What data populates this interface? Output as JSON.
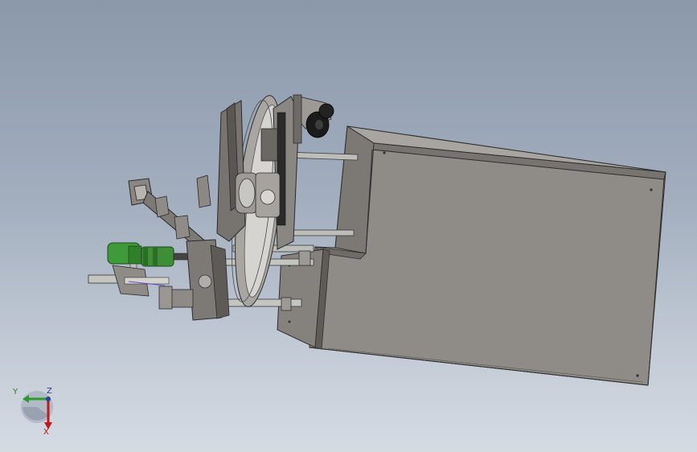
{
  "viewport": {
    "background_top": "#8a98aa",
    "background_bottom": "#d5dbe3",
    "model_color_housing": "#8f8b86",
    "model_color_dark": "#3e3c3a",
    "model_color_green": "#3f9a3a",
    "model_color_shaft": "#b6b6b2"
  },
  "triad": {
    "y_label": "Y",
    "z_label": "Z",
    "x_label": "X",
    "y_color": "#2f9a2f",
    "z_color": "#2b3f9a",
    "x_color": "#c41818"
  }
}
